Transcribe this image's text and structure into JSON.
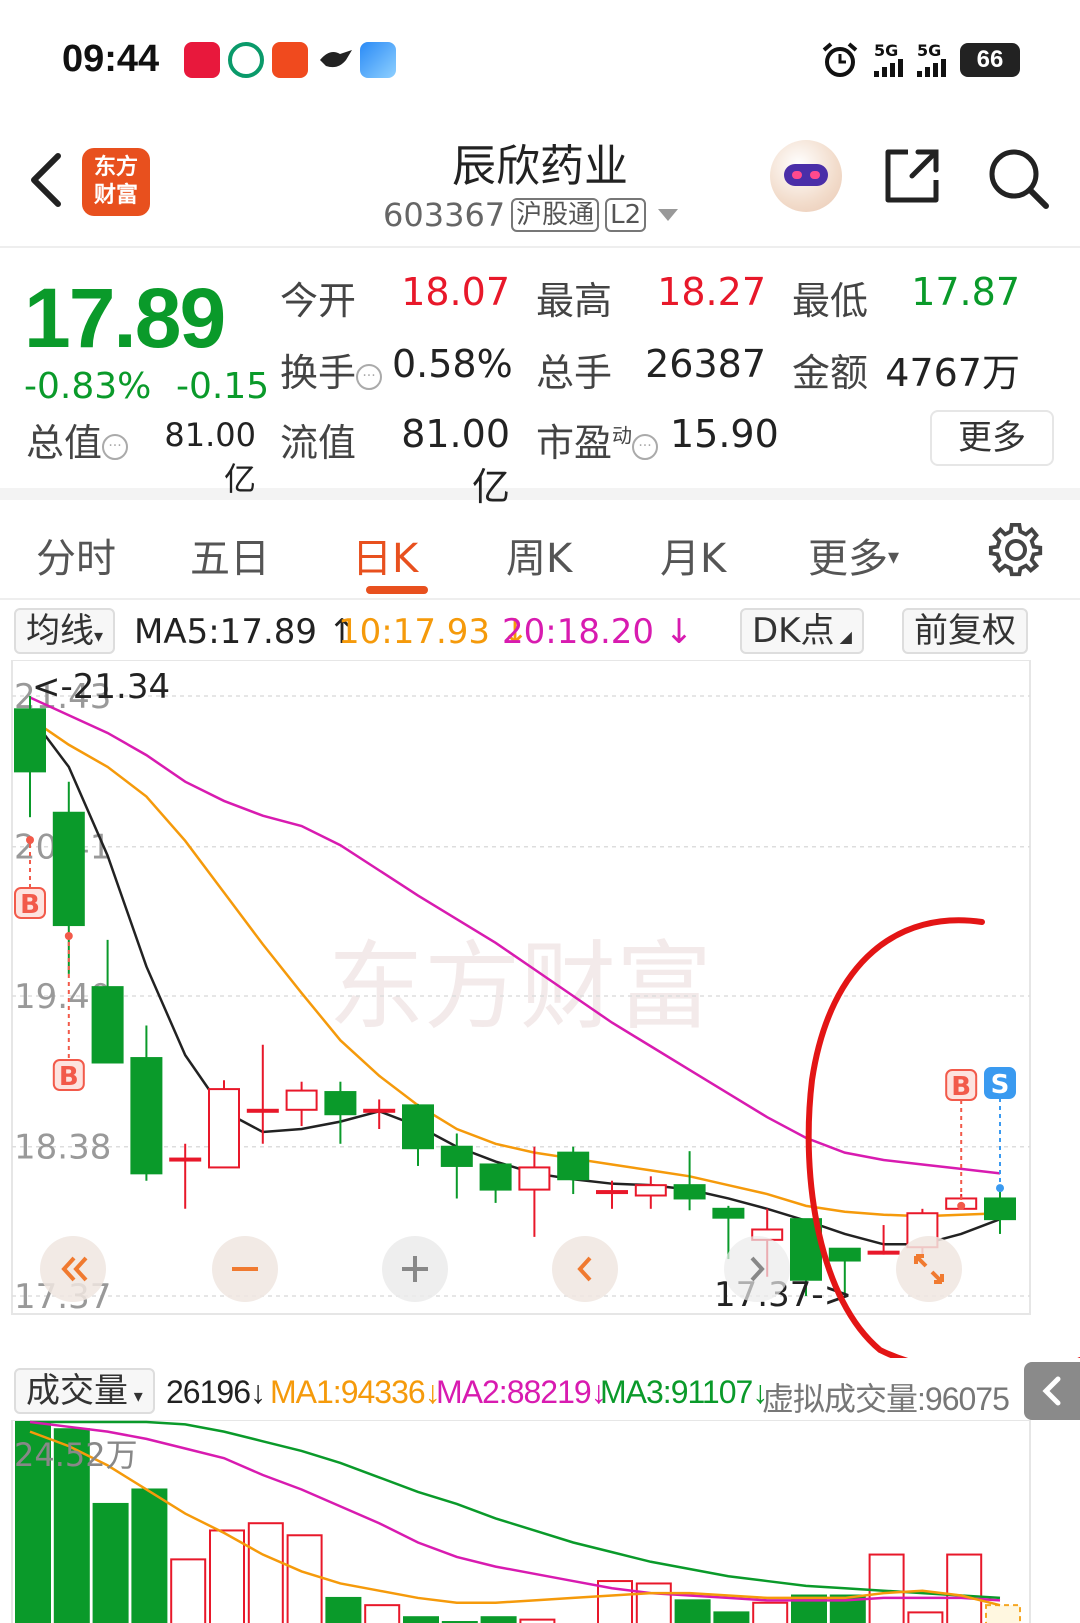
{
  "status": {
    "time": "09:44",
    "sig1": "5G",
    "sig2": "5G",
    "battery": "66"
  },
  "header": {
    "logo_line1": "东方",
    "logo_line2": "财富",
    "name": "辰欣药业",
    "code": "603367",
    "tag1": "沪股通",
    "tag2": "L2"
  },
  "quote": {
    "price": "17.89",
    "pct": "-0.83%",
    "change": "-0.15",
    "open_label": "今开",
    "open": "18.07",
    "high_label": "最高",
    "high": "18.27",
    "low_label": "最低",
    "low": "17.87",
    "turnover_label": "换手",
    "turnover": "0.58%",
    "volume_label": "总手",
    "volume": "26387",
    "amount_label": "金额",
    "amount": "4767万",
    "mktcap_label": "总值",
    "mktcap": "81.00亿",
    "float_label": "流值",
    "float": "81.00亿",
    "pe_label": "市盈",
    "pe_sup": "动",
    "pe": "15.90",
    "more": "更多"
  },
  "tabs": [
    "分时",
    "五日",
    "日K",
    "周K",
    "月K",
    "更多"
  ],
  "active_tab": 2,
  "ma": {
    "selector": "均线",
    "ma5": "MA5:17.89 ↑",
    "ma10": "10:17.93 ↓",
    "ma20": "20:18.20 ↓",
    "dk": "DK点",
    "adjust": "前复权"
  },
  "volume_bar": {
    "selector": "成交量",
    "vol": "26196↓",
    "ma1": "MA1:94336↓",
    "ma2": "MA2:88219↓",
    "ma3": "MA3:91107↓",
    "virtual": "虚拟成交量:96075"
  },
  "colors": {
    "up": "#e8182a",
    "down": "#0a9a2a",
    "accent": "#e8501e",
    "ma5": "#222222",
    "ma10": "#f59a0b",
    "ma20": "#d81bb0",
    "ma3": "#0a9a2a"
  },
  "chart_data": {
    "type": "candlestick",
    "y_ticks": [
      "21.43",
      "20.41",
      "19.40",
      "18.38",
      "17.37"
    ],
    "ylim": [
      17.37,
      21.43
    ],
    "max_label": "<-21.34",
    "min_label": "17.37->",
    "watermark": "东方财富",
    "candles": [
      {
        "o": 21.34,
        "c": 20.92,
        "h": 21.43,
        "l": 20.61
      },
      {
        "o": 20.64,
        "c": 19.88,
        "h": 20.85,
        "l": 19.55
      },
      {
        "o": 19.46,
        "c": 18.95,
        "h": 19.78,
        "l": 18.95
      },
      {
        "o": 18.98,
        "c": 18.2,
        "h": 19.2,
        "l": 18.15
      },
      {
        "o": 18.3,
        "c": 18.3,
        "h": 18.4,
        "l": 17.96
      },
      {
        "o": 18.24,
        "c": 18.77,
        "h": 18.83,
        "l": 18.24
      },
      {
        "o": 18.63,
        "c": 18.63,
        "h": 19.07,
        "l": 18.4
      },
      {
        "o": 18.63,
        "c": 18.76,
        "h": 18.82,
        "l": 18.52
      },
      {
        "o": 18.75,
        "c": 18.6,
        "h": 18.82,
        "l": 18.4
      },
      {
        "o": 18.63,
        "c": 18.63,
        "h": 18.7,
        "l": 18.5
      },
      {
        "o": 18.66,
        "c": 18.37,
        "h": 18.67,
        "l": 18.25
      },
      {
        "o": 18.38,
        "c": 18.25,
        "h": 18.47,
        "l": 18.03
      },
      {
        "o": 18.26,
        "c": 18.09,
        "h": 18.26,
        "l": 18.0
      },
      {
        "o": 18.09,
        "c": 18.24,
        "h": 18.38,
        "l": 17.77
      },
      {
        "o": 18.34,
        "c": 18.16,
        "h": 18.38,
        "l": 18.06
      },
      {
        "o": 18.08,
        "c": 18.08,
        "h": 18.15,
        "l": 17.96
      },
      {
        "o": 18.05,
        "c": 18.12,
        "h": 18.18,
        "l": 17.96
      },
      {
        "o": 18.12,
        "c": 18.03,
        "h": 18.35,
        "l": 17.95
      },
      {
        "o": 17.96,
        "c": 17.9,
        "h": 17.98,
        "l": 17.62
      },
      {
        "o": 17.75,
        "c": 17.82,
        "h": 17.96,
        "l": 17.5
      },
      {
        "o": 17.89,
        "c": 17.48,
        "h": 17.89,
        "l": 17.37
      },
      {
        "o": 17.69,
        "c": 17.61,
        "h": 17.69,
        "l": 17.37
      },
      {
        "o": 17.67,
        "c": 17.67,
        "h": 17.85,
        "l": 17.65
      },
      {
        "o": 17.7,
        "c": 17.93,
        "h": 17.96,
        "l": 17.65
      },
      {
        "o": 17.96,
        "c": 18.03,
        "h": 18.06,
        "l": 17.98
      },
      {
        "o": 18.03,
        "c": 17.89,
        "h": 18.1,
        "l": 17.79
      }
    ],
    "ma5": [
      21.3,
      20.95,
      20.35,
      19.6,
      19.0,
      18.62,
      18.48,
      18.5,
      18.55,
      18.62,
      18.52,
      18.38,
      18.28,
      18.2,
      18.16,
      18.13,
      18.12,
      18.09,
      18.03,
      17.96,
      17.88,
      17.79,
      17.72,
      17.72,
      17.79,
      17.89
    ],
    "ma10": [
      21.28,
      21.1,
      20.95,
      20.75,
      20.45,
      20.1,
      19.75,
      19.42,
      19.1,
      18.86,
      18.66,
      18.5,
      18.4,
      18.34,
      18.3,
      18.26,
      18.22,
      18.18,
      18.12,
      18.06,
      17.98,
      17.94,
      17.92,
      17.91,
      17.92,
      17.93
    ],
    "ma20": [
      21.42,
      21.3,
      21.18,
      21.03,
      20.85,
      20.72,
      20.62,
      20.55,
      20.42,
      20.25,
      20.08,
      19.92,
      19.76,
      19.58,
      19.4,
      19.22,
      19.06,
      18.9,
      18.74,
      18.58,
      18.44,
      18.34,
      18.29,
      18.26,
      18.23,
      18.2
    ],
    "signals": [
      {
        "index": 0,
        "type": "B"
      },
      {
        "index": 1,
        "type": "B"
      },
      {
        "index": 24,
        "type": "B"
      },
      {
        "index": 25,
        "type": "S"
      }
    ]
  },
  "volume_chart": {
    "y_top_label": "24.52万",
    "volumes_rel": [
      1.0,
      0.97,
      0.66,
      0.72,
      0.43,
      0.55,
      0.58,
      0.53,
      0.27,
      0.24,
      0.19,
      0.17,
      0.19,
      0.18,
      0.16,
      0.34,
      0.33,
      0.26,
      0.21,
      0.25,
      0.28,
      0.28,
      0.45,
      0.21,
      0.45,
      0.24
    ],
    "ma_lines_rel": {
      "ma1": [
        0.96,
        0.9,
        0.82,
        0.72,
        0.62,
        0.54,
        0.45,
        0.38,
        0.33,
        0.3,
        0.27,
        0.25,
        0.25,
        0.26,
        0.27,
        0.28,
        0.29,
        0.29,
        0.28,
        0.27,
        0.27,
        0.27,
        0.29,
        0.3,
        0.28,
        0.24
      ],
      "ma2": [
        1.0,
        0.98,
        0.96,
        0.93,
        0.89,
        0.85,
        0.78,
        0.72,
        0.65,
        0.58,
        0.5,
        0.44,
        0.4,
        0.37,
        0.34,
        0.31,
        0.29,
        0.28,
        0.27,
        0.26,
        0.26,
        0.26,
        0.27,
        0.27,
        0.27,
        0.26
      ],
      "ma3": [
        1.0,
        1.0,
        1.0,
        1.0,
        0.99,
        0.96,
        0.92,
        0.88,
        0.83,
        0.77,
        0.71,
        0.66,
        0.6,
        0.55,
        0.5,
        0.46,
        0.42,
        0.39,
        0.36,
        0.34,
        0.32,
        0.31,
        0.3,
        0.29,
        0.28,
        0.27
      ]
    }
  }
}
